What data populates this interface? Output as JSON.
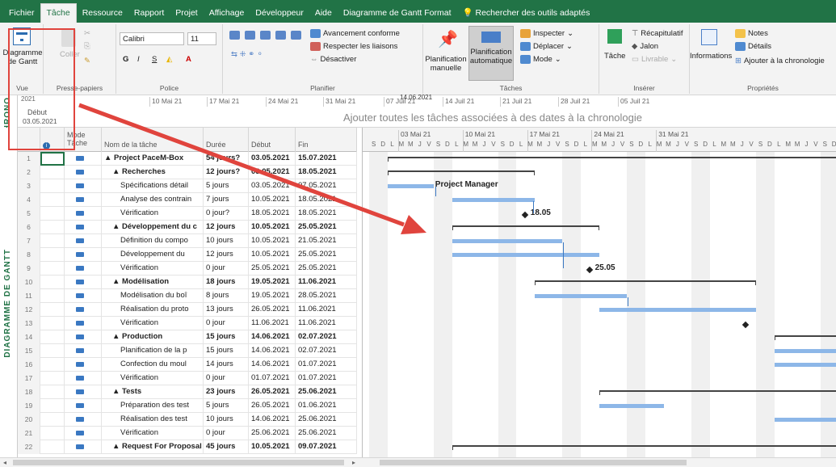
{
  "tabs": [
    "Fichier",
    "Tâche",
    "Ressource",
    "Rapport",
    "Projet",
    "Affichage",
    "Développeur",
    "Aide",
    "Diagramme de Gantt Format",
    "Rechercher des outils adaptés"
  ],
  "ribbon": {
    "view": {
      "label": "Diagramme de Gantt",
      "group": "Vue"
    },
    "clipboard": {
      "paste": "Coller",
      "group": "Presse-papiers"
    },
    "font": {
      "name": "Calibri",
      "size": "11",
      "group": "Police"
    },
    "schedule": {
      "a": "Avancement conforme",
      "b": "Respecter les liaisons",
      "c": "Désactiver",
      "group": "Planifier"
    },
    "tasks": {
      "manual": "Planification manuelle",
      "auto": "Planification automatique",
      "inspect": "Inspecter",
      "move": "Déplacer",
      "mode": "Mode",
      "group": "Tâches"
    },
    "insert": {
      "task": "Tâche",
      "summary": "Récapitulatif",
      "milestone": "Jalon",
      "deliverable": "Livrable",
      "group": "Insérer"
    },
    "props": {
      "info": "Informations",
      "notes": "Notes",
      "details": "Détails",
      "timeline": "Ajouter à la chronologie",
      "group": "Propriétés"
    }
  },
  "timeline": {
    "side": "CHRONO",
    "year": "2021",
    "start_label": "Début",
    "start_date": "03.05.2021",
    "today": "14.06.2021",
    "message": "Ajouter toutes les tâches associées à des dates à la chronologie",
    "ticks": [
      "10 Mai 21",
      "17 Mai 21",
      "24 Mai 21",
      "31 Mai 21",
      "07 Juil 21",
      "14 Juil 21",
      "21 Juil 21",
      "28 Juil 21",
      "05 Juil 21"
    ]
  },
  "side_label": "DIAGRAMME DE GANTT",
  "columns": {
    "mode": "Mode Tâche",
    "name": "Nom de la tâche",
    "dur": "Durée",
    "start": "Début",
    "end": "Fin"
  },
  "rows": [
    {
      "n": "1",
      "name": "▲ Project PaceM-Box",
      "dur": "54 jours?",
      "start": "03.05.2021",
      "end": "15.07.2021",
      "b": true,
      "ind": 0
    },
    {
      "n": "2",
      "name": "▲ Recherches",
      "dur": "12 jours?",
      "start": "03.05.2021",
      "end": "18.05.2021",
      "b": true,
      "ind": 1
    },
    {
      "n": "3",
      "name": "Spécifications détail",
      "dur": "5 jours",
      "start": "03.05.2021",
      "end": "07.05.2021",
      "b": false,
      "ind": 2
    },
    {
      "n": "4",
      "name": "Analyse des contrain",
      "dur": "7 jours",
      "start": "10.05.2021",
      "end": "18.05.2021",
      "b": false,
      "ind": 2
    },
    {
      "n": "5",
      "name": "Vérification",
      "dur": "0 jour?",
      "start": "18.05.2021",
      "end": "18.05.2021",
      "b": false,
      "ind": 2
    },
    {
      "n": "6",
      "name": "▲ Développement du c",
      "dur": "12 jours",
      "start": "10.05.2021",
      "end": "25.05.2021",
      "b": true,
      "ind": 1
    },
    {
      "n": "7",
      "name": "Définition du compo",
      "dur": "10 jours",
      "start": "10.05.2021",
      "end": "21.05.2021",
      "b": false,
      "ind": 2
    },
    {
      "n": "8",
      "name": "Développement du",
      "dur": "12 jours",
      "start": "10.05.2021",
      "end": "25.05.2021",
      "b": false,
      "ind": 2
    },
    {
      "n": "9",
      "name": "Vérification",
      "dur": "0 jour",
      "start": "25.05.2021",
      "end": "25.05.2021",
      "b": false,
      "ind": 2
    },
    {
      "n": "10",
      "name": "▲ Modélisation",
      "dur": "18 jours",
      "start": "19.05.2021",
      "end": "11.06.2021",
      "b": true,
      "ind": 1
    },
    {
      "n": "11",
      "name": "Modélisation du boî",
      "dur": "8 jours",
      "start": "19.05.2021",
      "end": "28.05.2021",
      "b": false,
      "ind": 2
    },
    {
      "n": "12",
      "name": "Réalisation du proto",
      "dur": "13 jours",
      "start": "26.05.2021",
      "end": "11.06.2021",
      "b": false,
      "ind": 2
    },
    {
      "n": "13",
      "name": "Vérification",
      "dur": "0 jour",
      "start": "11.06.2021",
      "end": "11.06.2021",
      "b": false,
      "ind": 2
    },
    {
      "n": "14",
      "name": "▲ Production",
      "dur": "15 jours",
      "start": "14.06.2021",
      "end": "02.07.2021",
      "b": true,
      "ind": 1
    },
    {
      "n": "15",
      "name": "Planification de la p",
      "dur": "15 jours",
      "start": "14.06.2021",
      "end": "02.07.2021",
      "b": false,
      "ind": 2
    },
    {
      "n": "16",
      "name": "Confection du moul",
      "dur": "14 jours",
      "start": "14.06.2021",
      "end": "01.07.2021",
      "b": false,
      "ind": 2
    },
    {
      "n": "17",
      "name": "Vérification",
      "dur": "0 jour",
      "start": "01.07.2021",
      "end": "01.07.2021",
      "b": false,
      "ind": 2
    },
    {
      "n": "18",
      "name": "▲ Tests",
      "dur": "23 jours",
      "start": "26.05.2021",
      "end": "25.06.2021",
      "b": true,
      "ind": 1
    },
    {
      "n": "19",
      "name": "Préparation des test",
      "dur": "5 jours",
      "start": "26.05.2021",
      "end": "01.06.2021",
      "b": false,
      "ind": 2
    },
    {
      "n": "20",
      "name": "Réalisation des test",
      "dur": "10 jours",
      "start": "14.06.2021",
      "end": "25.06.2021",
      "b": false,
      "ind": 2
    },
    {
      "n": "21",
      "name": "Vérification",
      "dur": "0 jour",
      "start": "25.06.2021",
      "end": "25.06.2021",
      "b": false,
      "ind": 2
    },
    {
      "n": "22",
      "name": "▲ Request For Proposal",
      "dur": "45 jours",
      "start": "10.05.2021",
      "end": "09.07.2021",
      "b": true,
      "ind": 1
    }
  ],
  "gantt": {
    "weeks": [
      "03 Mai 21",
      "10 Mai 21",
      "17 Mai 21",
      "24 Mai 21",
      "31 Mai 21"
    ],
    "days": [
      "L",
      "M",
      "M",
      "J",
      "V",
      "S",
      "D"
    ],
    "resource_label": "Project Manager",
    "milestone_1": "18.05",
    "milestone_2": "25.05"
  }
}
